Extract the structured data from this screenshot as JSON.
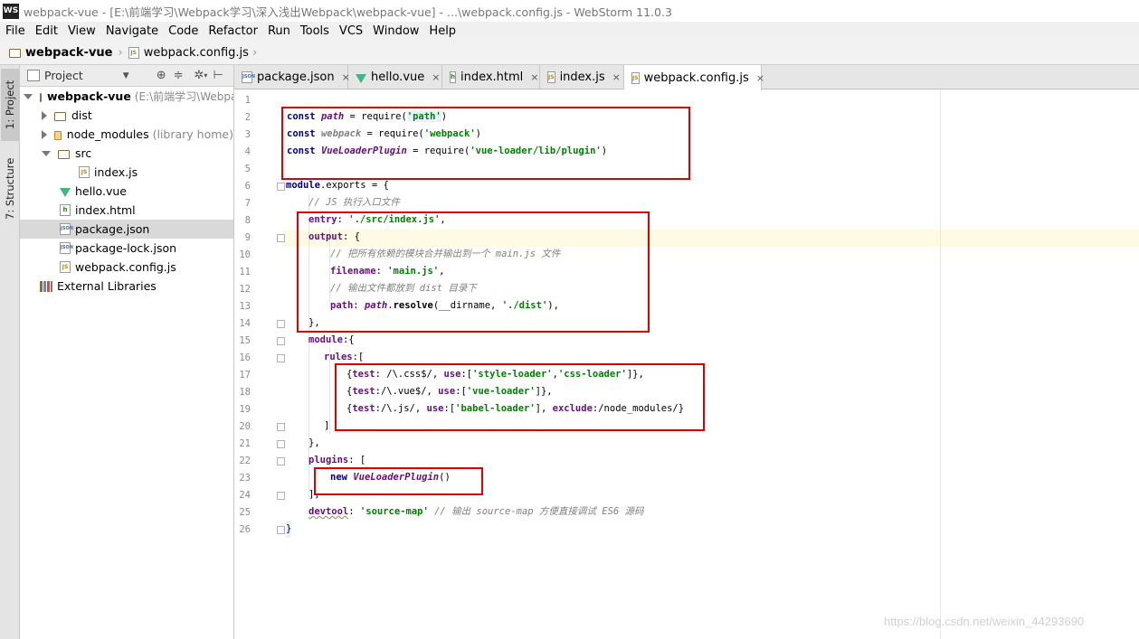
{
  "window": {
    "app_icon": "WS",
    "title": "webpack-vue - [E:\\前端学习\\Webpack学习\\深入浅出Webpack\\webpack-vue] - ...\\webpack.config.js - WebStorm 11.0.3"
  },
  "menu": [
    "File",
    "Edit",
    "View",
    "Navigate",
    "Code",
    "Refactor",
    "Run",
    "Tools",
    "VCS",
    "Window",
    "Help"
  ],
  "breadcrumb": {
    "project": "webpack-vue",
    "file": "webpack.config.js"
  },
  "side_tabs": {
    "project": "1: Project",
    "structure": "7: Structure"
  },
  "panel": {
    "title": "Project"
  },
  "tree": [
    {
      "label": "webpack-vue",
      "hint": "(E:\\前端学习\\Webpa",
      "icon": "folder-icon",
      "expanded": true
    },
    {
      "label": "dist",
      "icon": "folder-icon"
    },
    {
      "label": "node_modules",
      "hint": "(library home)",
      "icon": "folder-icon"
    },
    {
      "label": "src",
      "icon": "folder-icon",
      "expanded": true
    },
    {
      "label": "index.js",
      "icon": "js-file-icon"
    },
    {
      "label": "hello.vue",
      "icon": "vue-file-icon"
    },
    {
      "label": "index.html",
      "icon": "html-file-icon"
    },
    {
      "label": "package.json",
      "icon": "json-file-icon",
      "selected": true
    },
    {
      "label": "package-lock.json",
      "icon": "json-file-icon"
    },
    {
      "label": "webpack.config.js",
      "icon": "js-file-icon"
    },
    {
      "label": "External Libraries",
      "icon": "libraries-icon"
    }
  ],
  "tabs": [
    {
      "label": "package.json",
      "icon": "json-file-icon"
    },
    {
      "label": "hello.vue",
      "icon": "vue-file-icon"
    },
    {
      "label": "index.html",
      "icon": "html-file-icon"
    },
    {
      "label": "index.js",
      "icon": "js-file-icon"
    },
    {
      "label": "webpack.config.js",
      "icon": "js-file-icon",
      "active": true
    }
  ],
  "close_glyph": "×",
  "line_numbers": [
    "1",
    "2",
    "3",
    "4",
    "5",
    "6",
    "7",
    "8",
    "9",
    "10",
    "11",
    "12",
    "13",
    "14",
    "15",
    "16",
    "17",
    "18",
    "19",
    "20",
    "21",
    "22",
    "23",
    "24",
    "25",
    "26"
  ],
  "code": {
    "l2": [
      "const ",
      "path",
      " = require(",
      "'path'",
      ")"
    ],
    "l3": [
      "const ",
      "webpack",
      " = require(",
      "'webpack'",
      ")"
    ],
    "l4": [
      "const ",
      "VueLoaderPlugin",
      " = require(",
      "'vue-loader/lib/plugin'",
      ")"
    ],
    "l6": [
      "module",
      ".exports = {"
    ],
    "l7": "// JS 执行入口文件",
    "l8": [
      "entry",
      ": ",
      "'./src/index.js'",
      ","
    ],
    "l9": [
      "output",
      ": {"
    ],
    "l10": "// 把所有依赖的模块合并输出到一个 main.js 文件",
    "l11": [
      "filename",
      ": ",
      "'main.js'",
      ","
    ],
    "l12": "// 输出文件都放到 dist 目录下",
    "l13": [
      "path",
      ": ",
      "path",
      ".",
      "resolve",
      "(__dirname, ",
      "'./dist'",
      "),"
    ],
    "l14": "},",
    "l15": [
      "module",
      ":{"
    ],
    "l16": [
      "rules",
      ":["
    ],
    "l17": [
      "{",
      "test",
      ": /\\.css$/, ",
      "use",
      ":[",
      "'style-loader'",
      ",",
      "'css-loader'",
      "]},"
    ],
    "l18": [
      "{",
      "test",
      ":/\\.vue$/, ",
      "use",
      ":[",
      "'vue-loader'",
      "]},"
    ],
    "l19": [
      "{",
      "test",
      ":/\\.js/, ",
      "use",
      ":[",
      "'babel-loader'",
      "], ",
      "exclude",
      ":/node_modules/}"
    ],
    "l20": "]",
    "l21": "},",
    "l22": [
      "plugins",
      ": ["
    ],
    "l23": [
      "new ",
      "VueLoaderPlugin",
      "()"
    ],
    "l24": "],",
    "l25": [
      "devtool",
      ": ",
      "'source-map'",
      " // 输出 source-map 方便直接调试 ES6 源码"
    ],
    "l26": "}"
  },
  "watermark": "https://blog.csdn.net/weixin_44293690",
  "colors": {
    "annotation_box": "#e00000",
    "keyword": "#000080",
    "string": "#008000",
    "property": "#660e7a",
    "comment": "#808080"
  }
}
